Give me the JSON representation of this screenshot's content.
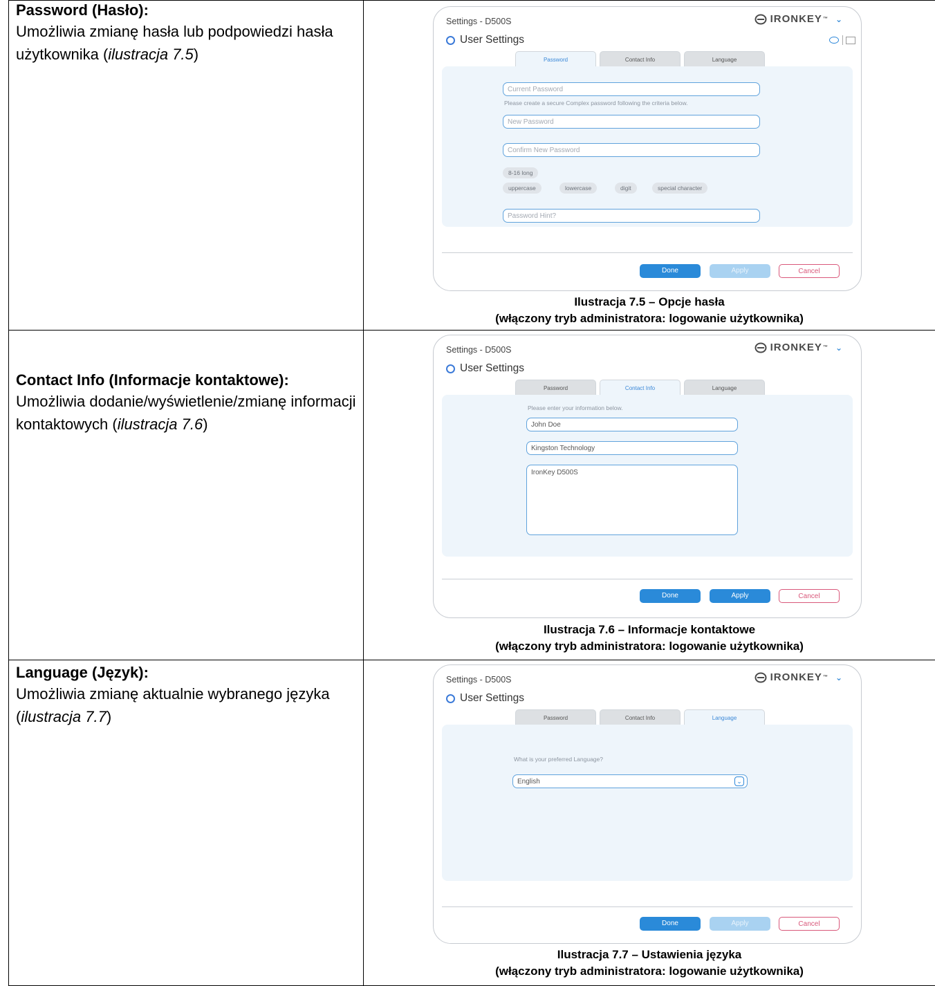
{
  "rows": [
    {
      "heading": "Password (Hasło):",
      "text_before": "Umożliwia zmianę hasła lub podpowiedzi hasła użytkownika (",
      "text_italic": "ilustracja 7.5",
      "text_after": ")",
      "caption_line1": "Ilustracja 7.5 – Opcje hasła",
      "caption_line2": "(włączony tryb administratora: logowanie użytkownika)"
    },
    {
      "heading": "Contact Info (Informacje kontaktowe):",
      "text_before": "Umożliwia dodanie/wyświetlenie/zmianę informacji kontaktowych (",
      "text_italic": "ilustracja 7.6",
      "text_after": ")",
      "caption_line1": "Ilustracja 7.6 – Informacje kontaktowe",
      "caption_line2": "(włączony tryb administratora: logowanie użytkownika)"
    },
    {
      "heading": "Language (Język):",
      "text_before": "Umożliwia zmianę aktualnie wybranego języka (",
      "text_italic": "ilustracja 7.7",
      "text_after": ")",
      "caption_line1": "Ilustracja 7.7 – Ustawienia języka",
      "caption_line2": "(włączony tryb administratora: logowanie użytkownika)"
    }
  ],
  "window": {
    "title": "Settings - D500S",
    "brand": "IRONKEY",
    "brand_tm": "™",
    "section": "User Settings",
    "tabs": [
      "Password",
      "Contact Info",
      "Language"
    ],
    "buttons": {
      "done": "Done",
      "apply": "Apply",
      "cancel": "Cancel"
    }
  },
  "password_tab": {
    "current_placeholder": "Current Password",
    "instruction": "Please create a secure Complex password following the criteria below.",
    "new_placeholder": "New Password",
    "confirm_placeholder": "Confirm New Password",
    "criteria_row1": [
      "8-16 long"
    ],
    "criteria_row2": [
      "uppercase",
      "lowercase",
      "digit",
      "special character"
    ],
    "hint_placeholder": "Password Hint?"
  },
  "contact_tab": {
    "instruction": "Please enter your information below.",
    "name": "John Doe",
    "company": "Kingston Technology",
    "details": "IronKey D500S"
  },
  "language_tab": {
    "question": "What is your preferred Language?",
    "selected": "English"
  }
}
